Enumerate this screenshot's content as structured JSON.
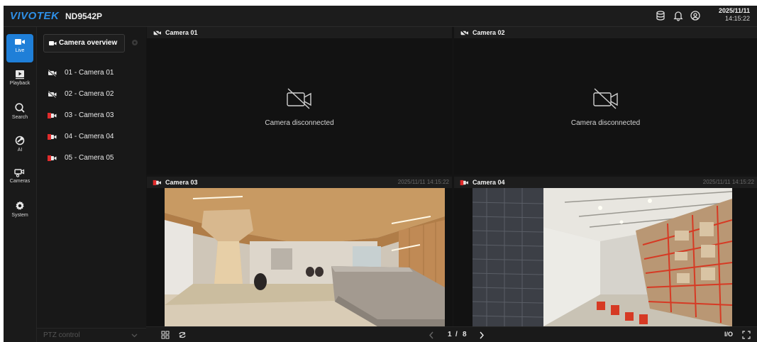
{
  "header": {
    "brand": "VIVOTEK",
    "model": "ND9542P",
    "date": "2025/11/11",
    "time": "14:15:22"
  },
  "sidebar": {
    "items": [
      {
        "label": "Live",
        "icon": "video-camera-icon",
        "active": true
      },
      {
        "label": "Playback",
        "icon": "playback-icon"
      },
      {
        "label": "Search",
        "icon": "search-icon"
      },
      {
        "label": "AI",
        "icon": "ai-icon"
      },
      {
        "label": "Cameras",
        "icon": "cameras-icon"
      },
      {
        "label": "System",
        "icon": "gear-icon"
      }
    ]
  },
  "camera_panel": {
    "overview_label": "Camera overview",
    "cameras": [
      {
        "label": "01 - Camera 01",
        "status": "disconnected"
      },
      {
        "label": "02 - Camera 02",
        "status": "disconnected"
      },
      {
        "label": "03 - Camera 03",
        "status": "recording"
      },
      {
        "label": "04 - Camera 04",
        "status": "recording"
      },
      {
        "label": "05 - Camera 05",
        "status": "recording"
      }
    ],
    "ptz_label": "PTZ control"
  },
  "tiles": [
    {
      "name": "Camera 01",
      "status_text": "Camera disconnected",
      "timestamp": ""
    },
    {
      "name": "Camera 02",
      "status_text": "Camera disconnected",
      "timestamp": ""
    },
    {
      "name": "Camera 03",
      "status_text": "",
      "timestamp": "2025/11/11 14:15:22"
    },
    {
      "name": "Camera 04",
      "status_text": "",
      "timestamp": "2025/11/11 14:15:22"
    }
  ],
  "bottombar": {
    "page_current": "1",
    "page_sep": "/",
    "page_total": "8",
    "io_label": "I/O"
  },
  "colors": {
    "accent": "#1f7fd8",
    "recording": "#e02b2b",
    "background": "#141414"
  }
}
